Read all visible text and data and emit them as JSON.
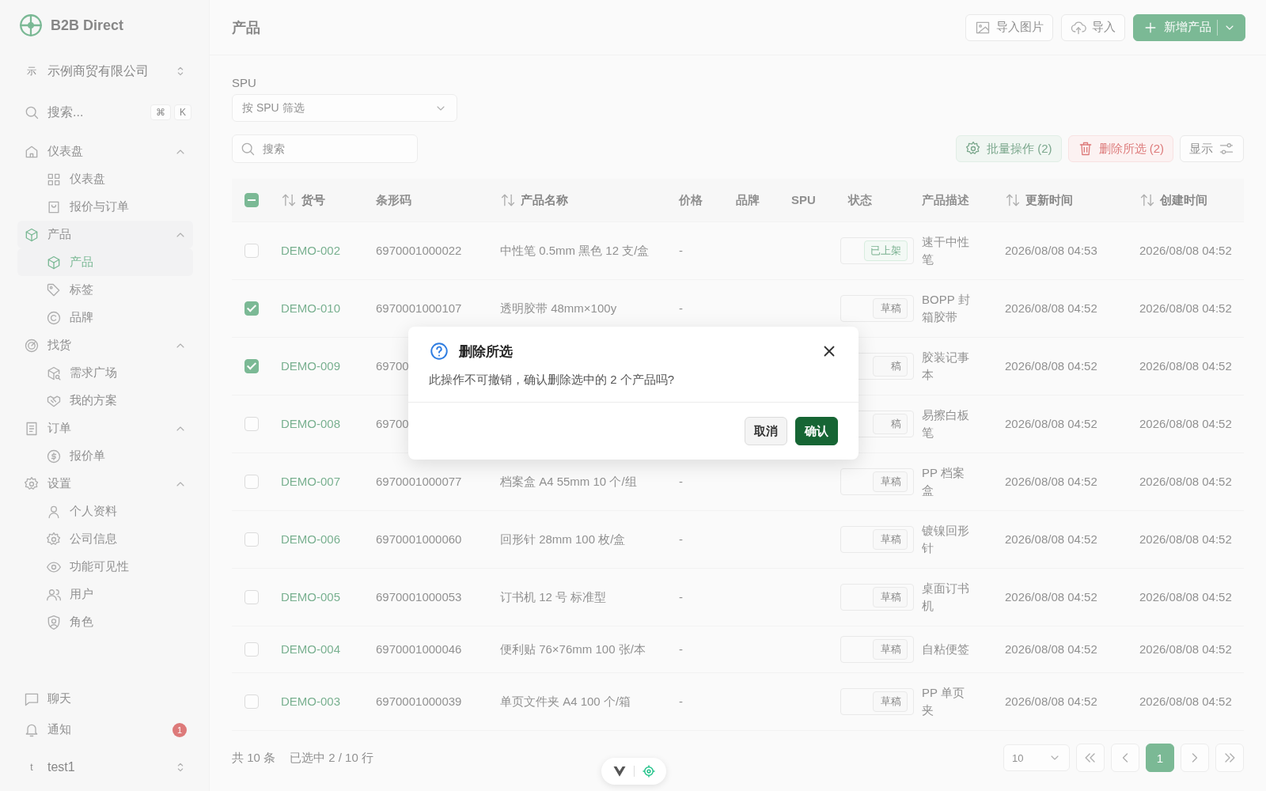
{
  "sidebar": {
    "brand": "B2B Direct",
    "org": {
      "avatar": "示",
      "name": "示例商贸有限公司"
    },
    "search": {
      "placeholder": "搜索...",
      "keys": [
        "⌘",
        "K"
      ]
    },
    "nav": [
      {
        "label": "仪表盘",
        "selected": false,
        "expanded": true,
        "children": [
          {
            "label": "仪表盘",
            "selected": false
          },
          {
            "label": "报价与订单",
            "selected": false
          }
        ]
      },
      {
        "label": "产品",
        "selected": true,
        "expanded": true,
        "children": [
          {
            "label": "产品",
            "selected": true
          },
          {
            "label": "标签",
            "selected": false
          },
          {
            "label": "品牌",
            "selected": false
          }
        ]
      },
      {
        "label": "找货",
        "selected": false,
        "expanded": true,
        "children": [
          {
            "label": "需求广场",
            "selected": false
          },
          {
            "label": "我的方案",
            "selected": false
          }
        ]
      },
      {
        "label": "订单",
        "selected": false,
        "expanded": true,
        "children": [
          {
            "label": "报价单",
            "selected": false
          }
        ]
      },
      {
        "label": "设置",
        "selected": false,
        "expanded": true,
        "children": [
          {
            "label": "个人资料",
            "selected": false
          },
          {
            "label": "公司信息",
            "selected": false
          },
          {
            "label": "功能可见性",
            "selected": false
          },
          {
            "label": "用户",
            "selected": false
          },
          {
            "label": "角色",
            "selected": false
          }
        ]
      }
    ],
    "footer": [
      {
        "label": "聊天"
      },
      {
        "label": "通知",
        "badge": "1"
      }
    ],
    "user": {
      "avatar": "t",
      "name": "test1"
    }
  },
  "header": {
    "title": "产品",
    "actions": [
      {
        "label": "导入图片",
        "kind": "image"
      },
      {
        "label": "导入",
        "kind": "upload"
      },
      {
        "label": "新增产品",
        "kind": "primary"
      }
    ]
  },
  "filters": {
    "spu_label": "SPU",
    "spu_placeholder": "按 SPU 筛选",
    "search_placeholder": "搜索"
  },
  "toolbar": [
    {
      "label": "批量操作 (2)",
      "kind": "bulk"
    },
    {
      "label": "删除所选 (2)",
      "kind": "danger"
    },
    {
      "label": "显示",
      "kind": "view"
    }
  ],
  "table": {
    "indeterminate": true,
    "columns": [
      {
        "label": "货号",
        "sortable": true
      },
      {
        "label": "条形码",
        "sortable": false
      },
      {
        "label": "产品名称",
        "sortable": true
      },
      {
        "label": "价格",
        "sortable": false
      },
      {
        "label": "品牌",
        "sortable": false
      },
      {
        "label": "SPU",
        "sortable": false
      },
      {
        "label": "状态",
        "sortable": false
      },
      {
        "label": "产品描述",
        "sortable": false
      },
      {
        "label": "更新时间",
        "sortable": true
      },
      {
        "label": "创建时间",
        "sortable": true
      }
    ],
    "rows": [
      {
        "checked": false,
        "sku": "DEMO-002",
        "barcode": "6970001000022",
        "name": "中性笔 0.5mm 黑色 12 支/盒",
        "price": "-",
        "status": {
          "label": "已上架",
          "kind": "published"
        },
        "description": "速干中性笔",
        "updated": "2026/08/08 04:53",
        "created": "2026/08/08 04:52"
      },
      {
        "checked": true,
        "sku": "DEMO-010",
        "barcode": "6970001000107",
        "name": "透明胶带 48mm×100y",
        "price": "-",
        "status": {
          "label": "草稿",
          "kind": "draft"
        },
        "description": "BOPP 封箱胶带",
        "updated": "2026/08/08 04:52",
        "created": "2026/08/08 04:52"
      },
      {
        "checked": true,
        "sku": "DEMO-009",
        "barcode": "69700",
        "status": {
          "label": "稿",
          "kind": "draft"
        },
        "description": "胶装记事本",
        "updated": "2026/08/08 04:52",
        "created": "2026/08/08 04:52"
      },
      {
        "checked": false,
        "sku": "DEMO-008",
        "barcode": "69700",
        "status": {
          "label": "稿",
          "kind": "draft"
        },
        "description": "易擦白板笔",
        "updated": "2026/08/08 04:52",
        "created": "2026/08/08 04:52"
      },
      {
        "checked": false,
        "sku": "DEMO-007",
        "barcode": "6970001000077",
        "name": "档案盒 A4 55mm 10 个/组",
        "price": "-",
        "status": {
          "label": "草稿",
          "kind": "draft"
        },
        "description": "PP 档案盒",
        "updated": "2026/08/08 04:52",
        "created": "2026/08/08 04:52"
      },
      {
        "checked": false,
        "sku": "DEMO-006",
        "barcode": "6970001000060",
        "name": "回形针 28mm 100 枚/盒",
        "price": "-",
        "status": {
          "label": "草稿",
          "kind": "draft"
        },
        "description": "镀镍回形针",
        "updated": "2026/08/08 04:52",
        "created": "2026/08/08 04:52"
      },
      {
        "checked": false,
        "sku": "DEMO-005",
        "barcode": "6970001000053",
        "name": "订书机 12 号 标准型",
        "price": "-",
        "status": {
          "label": "草稿",
          "kind": "draft"
        },
        "description": "桌面订书机",
        "updated": "2026/08/08 04:52",
        "created": "2026/08/08 04:52"
      },
      {
        "checked": false,
        "sku": "DEMO-004",
        "barcode": "6970001000046",
        "name": "便利贴 76×76mm 100 张/本",
        "price": "-",
        "status": {
          "label": "草稿",
          "kind": "draft"
        },
        "description": "自粘便签",
        "updated": "2026/08/08 04:52",
        "created": "2026/08/08 04:52"
      },
      {
        "checked": false,
        "sku": "DEMO-003",
        "barcode": "6970001000039",
        "name": "单页文件夹 A4 100 个/箱",
        "price": "-",
        "status": {
          "label": "草稿",
          "kind": "draft"
        },
        "description": "PP 单页夹",
        "updated": "2026/08/08 04:52",
        "created": "2026/08/08 04:52"
      }
    ]
  },
  "footer": {
    "total": "共 10 条",
    "selection": "已选中 2 / 10 行",
    "page_size": "10",
    "pages": [
      {
        "label": "1",
        "selected": true
      }
    ]
  },
  "dialog": {
    "title": "删除所选",
    "message": "此操作不可撤销，确认删除选中的 2 个产品吗?",
    "buttons": [
      {
        "label": "取消",
        "kind": "cancel"
      },
      {
        "label": "确认",
        "kind": "confirm"
      }
    ]
  }
}
